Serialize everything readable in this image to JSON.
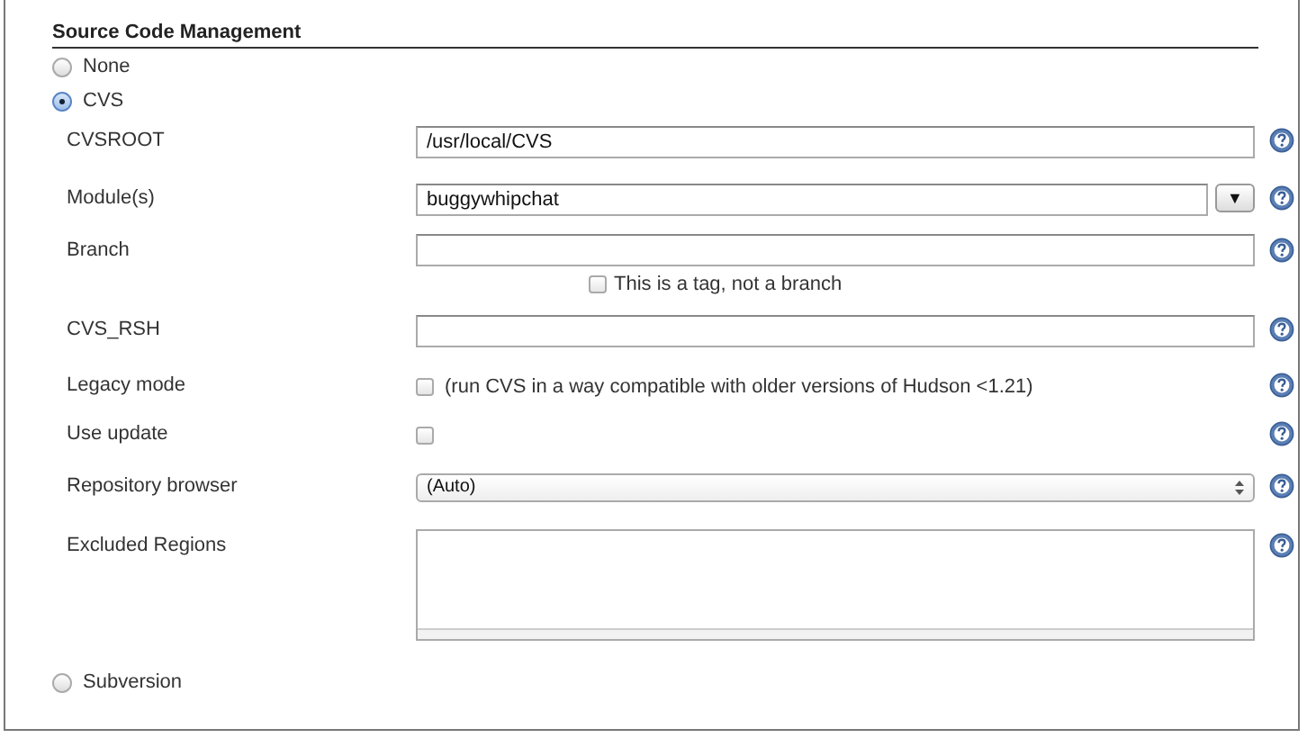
{
  "section": {
    "title": "Source Code Management"
  },
  "options": [
    {
      "label": "None",
      "selected": false
    },
    {
      "label": "CVS",
      "selected": true,
      "fields": [
        {
          "kind": "text",
          "label": "CVSROOT",
          "value": "/usr/local/CVS"
        },
        {
          "kind": "combo",
          "label": "Module(s)",
          "value": "buggywhipchat",
          "button": "▼"
        },
        {
          "kind": "text",
          "label": "Branch",
          "option": {
            "label": "This is a tag, not a branch",
            "checked": false
          }
        },
        {
          "kind": "text",
          "label": "CVS_RSH"
        },
        {
          "kind": "checkbox",
          "label": "Legacy mode",
          "checked": false,
          "caption": "(run CVS in a way compatible with older versions of Hudson <1.21)"
        },
        {
          "kind": "checkbox",
          "label": "Use update",
          "checked": false
        },
        {
          "kind": "select",
          "label": "Repository browser",
          "value": "(Auto)"
        },
        {
          "kind": "textarea",
          "label": "Excluded Regions"
        }
      ]
    },
    {
      "label": "Subversion",
      "selected": false
    }
  ]
}
